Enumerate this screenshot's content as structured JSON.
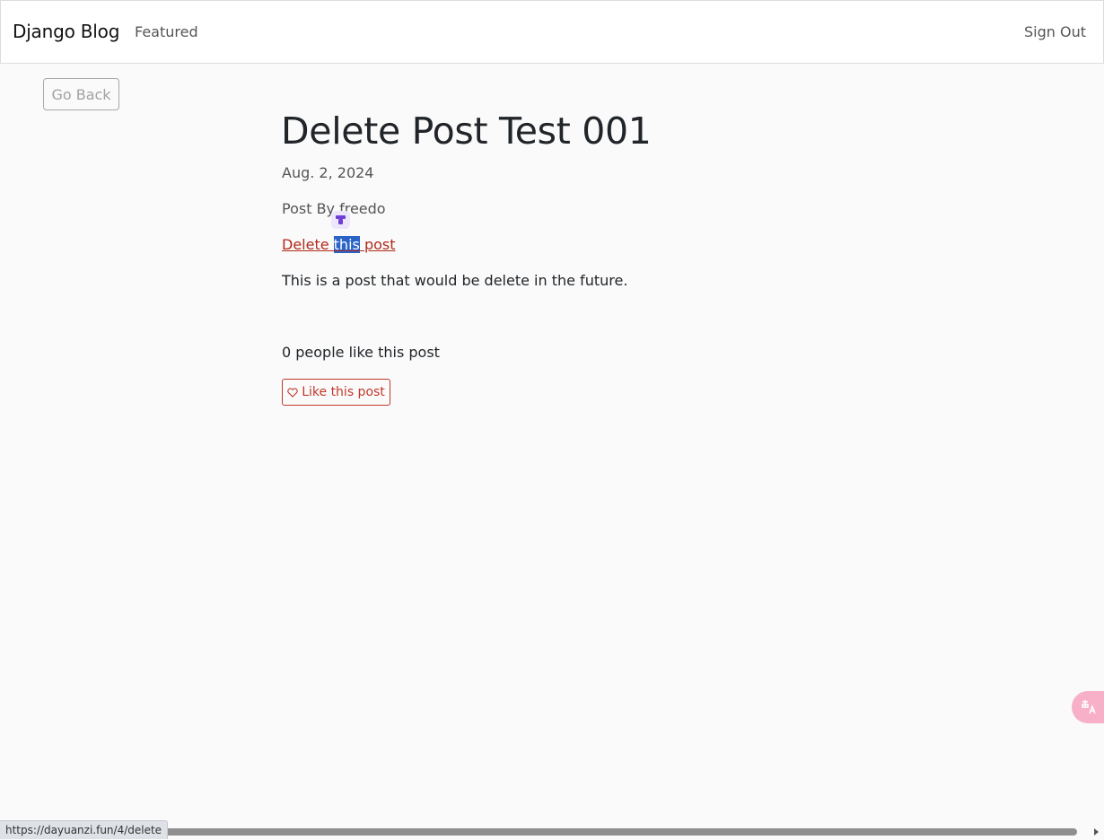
{
  "navbar": {
    "brand": "Django Blog",
    "featured": "Featured",
    "sign_out": "Sign Out"
  },
  "go_back": "Go Back",
  "post": {
    "title": "Delete Post Test 001",
    "date": "Aug. 2, 2024",
    "author_line": "Post By freedo",
    "delete_link": {
      "before": "Delete ",
      "selected": "this",
      "after": " post"
    },
    "body": "This is a post that would be delete in the future.",
    "likes_text": "0 people like this post",
    "like_button": "Like this post"
  },
  "status_bar": {
    "url": "https://dayuanzi.fun/4/delete"
  },
  "colors": {
    "background": "#fafafa",
    "link_red": "#b02a1a",
    "selection": "#2b63c6",
    "like_red": "#c0392b"
  }
}
